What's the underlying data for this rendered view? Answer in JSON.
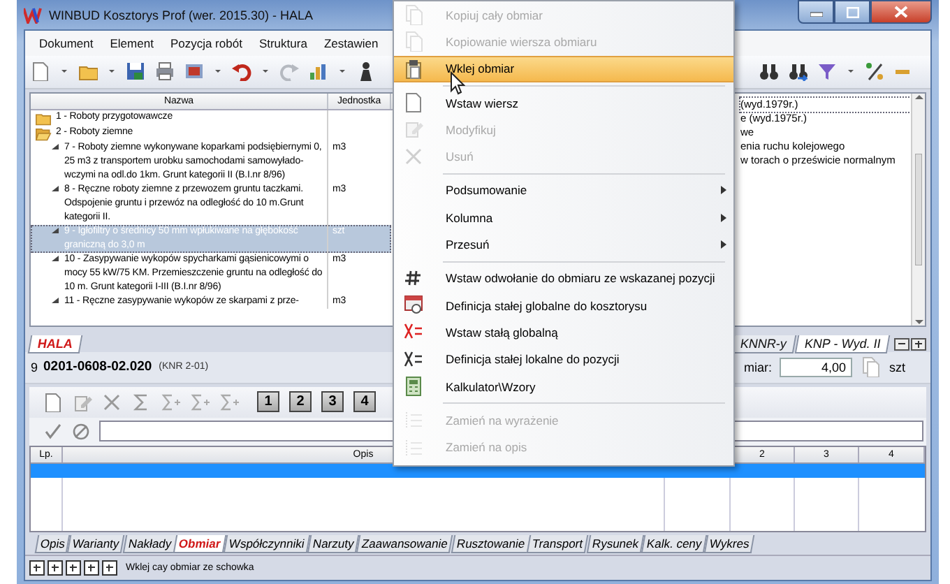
{
  "window": {
    "title": "WINBUD Kosztorys Prof (wer. 2015.30) - HALA"
  },
  "menu_bar": [
    {
      "label": "Dokument"
    },
    {
      "label": "Element"
    },
    {
      "label": "Pozycja robót"
    },
    {
      "label": "Struktura"
    },
    {
      "label": "Zestawien"
    }
  ],
  "positions_table": {
    "columns": [
      "Nazwa",
      "Jednostka"
    ],
    "rows": [
      {
        "kind": "group",
        "name": "1 - Roboty przygotowawcze",
        "expanded": false,
        "selected": false
      },
      {
        "kind": "group",
        "name": "2 - Roboty ziemne",
        "expanded": true,
        "selected": false
      },
      {
        "kind": "item",
        "name": "7 - Roboty ziemne wykonywane koparkami podsiębiernymi 0, 25 m3 z transportem urobku samochodami samowyłado-wczymi na odl.do 1km. Grunt kategorii II (B.I.nr 8/96)",
        "unit": "m3",
        "selected": false
      },
      {
        "kind": "item",
        "name": "8 - Ręczne roboty ziemne z przewozem gruntu taczkami. Odspojenie gruntu i przewóz na odległość do 10 m.Grunt kategorii II.",
        "unit": "m3",
        "selected": false
      },
      {
        "kind": "item",
        "name": "9 - Igłofiltry o średnicy 50 mm wpłukiwane na głębokość graniczną do 3,0 m",
        "unit": "szt",
        "selected": true
      },
      {
        "kind": "item",
        "name": "10 - Zasypywanie wykopów spycharkami gąsienicowymi o mocy 55 kW/75 KM. Przemieszczenie gruntu na odległość do 10 m. Grunt kategorii I-III (B.I.nr 8/96)",
        "unit": "m3",
        "selected": false
      },
      {
        "kind": "item",
        "name": "11 - Ręczne zasypywanie wykopów ze skarpami z prze-",
        "unit": "m3",
        "selected": false
      }
    ]
  },
  "catalog_list": {
    "rows": [
      {
        "text": "(wyd.1979r.)",
        "selected": true
      },
      {
        "text": "e (wyd.1975r.)",
        "selected": false
      },
      {
        "text": "we",
        "selected": false
      },
      {
        "text": "enia ruchu kolejowego",
        "selected": false
      },
      {
        "text": "w torach o prześwicie normalnym",
        "selected": false
      }
    ]
  },
  "upper_tabs": [
    {
      "label": "HALA",
      "selected": true
    }
  ],
  "catalog_tabs": [
    {
      "label": "KNNR-y",
      "selected": false
    },
    {
      "label": "KNP - Wyd. II",
      "selected": true
    }
  ],
  "position": {
    "number": "9",
    "code": "0201-0608-02.020",
    "source": "(KNR 2-01)",
    "quantity_label": "miar:",
    "quantity": "4,00",
    "unit": "szt"
  },
  "measure_toolbar": {
    "column_buttons": [
      "1",
      "2",
      "3",
      "4"
    ]
  },
  "measure_grid": {
    "columns": [
      "Lp.",
      "Opis",
      "2",
      "3",
      "4"
    ],
    "rows": [
      {
        "selected": true
      }
    ]
  },
  "detail_tabs": [
    {
      "label": "Opis",
      "selected": false
    },
    {
      "label": "Warianty",
      "selected": false
    },
    {
      "label": "Nakłady",
      "selected": false
    },
    {
      "label": "Obmiar",
      "selected": true
    },
    {
      "label": "Współczynniki",
      "selected": false
    },
    {
      "label": "Narzuty",
      "selected": false
    },
    {
      "label": "Zaawansowanie",
      "selected": false
    },
    {
      "label": "Rusztowanie",
      "selected": false
    },
    {
      "label": "Transport",
      "selected": false
    },
    {
      "label": "Rysunek",
      "selected": false
    },
    {
      "label": "Kalk. ceny",
      "selected": false
    },
    {
      "label": "Wykres",
      "selected": false
    }
  ],
  "status_bar": {
    "text": "Wklej cay obmiar ze schowka"
  },
  "context_menu": {
    "items": [
      {
        "kind": "item",
        "label": "Kopiuj cały obmiar",
        "disabled": true,
        "selected": false,
        "submenu": false
      },
      {
        "kind": "item",
        "label": "Kopiowanie wiersza obmiaru",
        "disabled": true,
        "selected": false,
        "submenu": false
      },
      {
        "kind": "item",
        "label": "Wklej obmiar",
        "disabled": false,
        "selected": true,
        "submenu": false
      },
      {
        "kind": "separator"
      },
      {
        "kind": "item",
        "label": "Wstaw wiersz",
        "disabled": false,
        "selected": false,
        "submenu": false
      },
      {
        "kind": "item",
        "label": "Modyfikuj",
        "disabled": true,
        "selected": false,
        "submenu": false
      },
      {
        "kind": "item",
        "label": "Usuń",
        "disabled": true,
        "selected": false,
        "submenu": false
      },
      {
        "kind": "separator"
      },
      {
        "kind": "item",
        "label": "Podsumowanie",
        "disabled": false,
        "selected": false,
        "submenu": true
      },
      {
        "kind": "item",
        "label": "Kolumna",
        "disabled": false,
        "selected": false,
        "submenu": true
      },
      {
        "kind": "item",
        "label": "Przesuń",
        "disabled": false,
        "selected": false,
        "submenu": true
      },
      {
        "kind": "separator"
      },
      {
        "kind": "item",
        "label": "Wstaw odwołanie do obmiaru ze wskazanej pozycji",
        "disabled": false,
        "selected": false,
        "submenu": false
      },
      {
        "kind": "item",
        "label": "Definicja stałej globalne do kosztorysu",
        "disabled": false,
        "selected": false,
        "submenu": false
      },
      {
        "kind": "item",
        "label": "Wstaw stałą globalną",
        "disabled": false,
        "selected": false,
        "submenu": false
      },
      {
        "kind": "item",
        "label": "Definicja stałej lokalne do pozycji",
        "disabled": false,
        "selected": false,
        "submenu": false
      },
      {
        "kind": "item",
        "label": "Kalkulator\\Wzory",
        "disabled": false,
        "selected": false,
        "submenu": false
      },
      {
        "kind": "separator"
      },
      {
        "kind": "item",
        "label": "Zamień na wyrażenie",
        "disabled": true,
        "selected": false,
        "submenu": false
      },
      {
        "kind": "item",
        "label": "Zamień na opis",
        "disabled": true,
        "selected": false,
        "submenu": false
      }
    ]
  }
}
